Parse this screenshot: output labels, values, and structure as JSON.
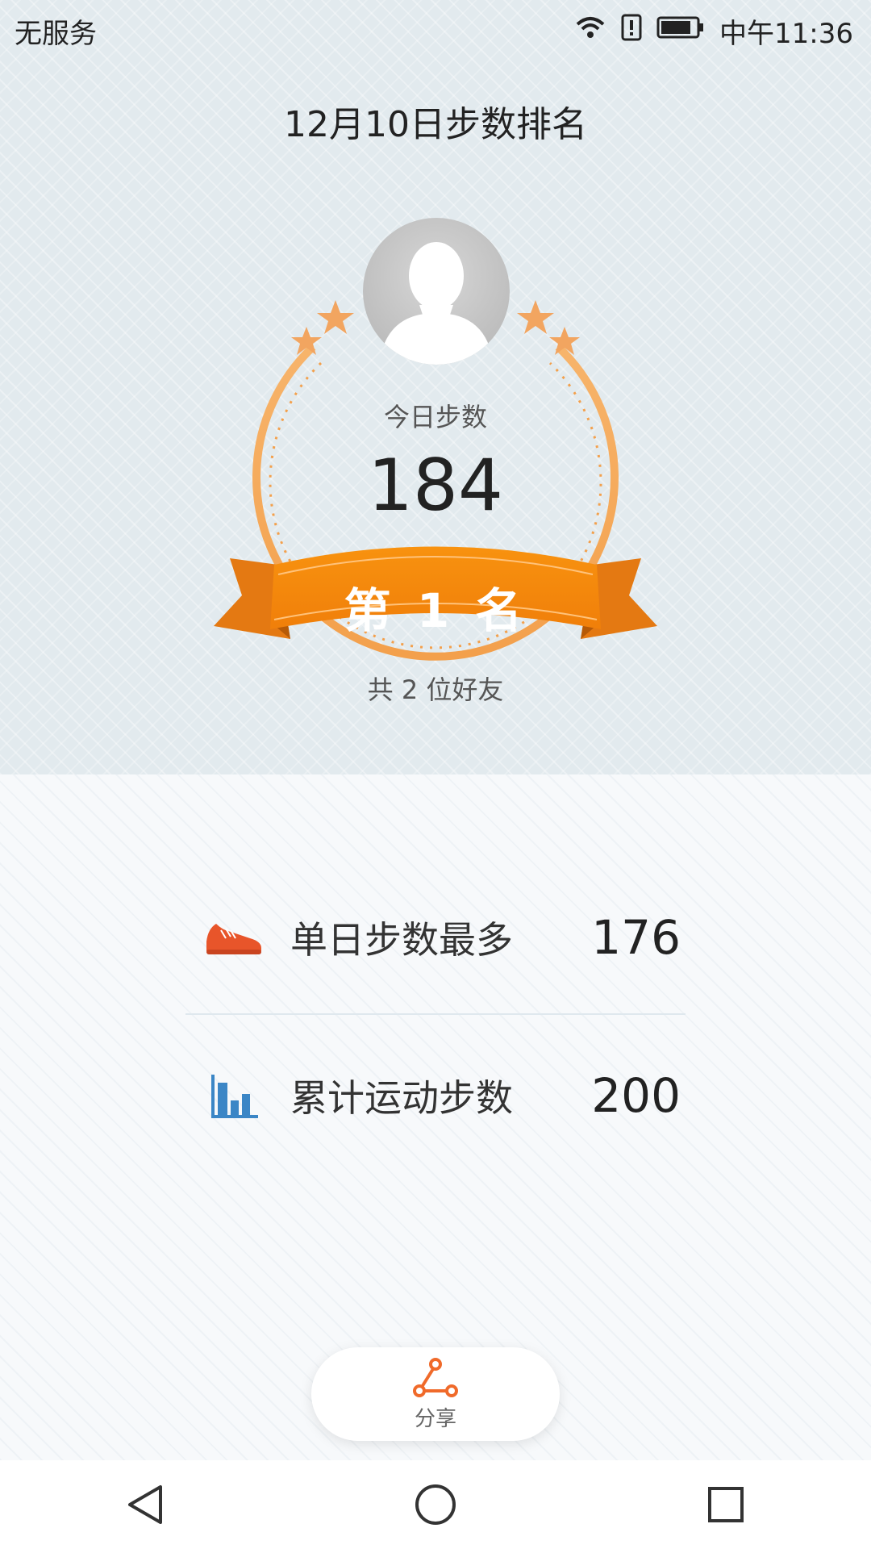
{
  "status_bar": {
    "carrier": "无服务",
    "time": "中午11:36",
    "icons": [
      "wifi-icon",
      "sim-alert-icon",
      "battery-icon"
    ]
  },
  "page": {
    "title": "12月10日步数排名"
  },
  "badge": {
    "avatar": "avatar-icon",
    "today_label": "今日步数",
    "today_steps": "184",
    "rank": "第 1 名",
    "friends": "共 2 位好友"
  },
  "stats": [
    {
      "icon": "shoe-icon",
      "label": "单日步数最多",
      "value": "176"
    },
    {
      "icon": "bar-chart-icon",
      "label": "累计运动步数",
      "value": "200"
    }
  ],
  "share": {
    "icon": "share-icon",
    "label": "分享"
  },
  "nav": {
    "icons": [
      "back-icon",
      "home-icon",
      "recents-icon"
    ]
  },
  "colors": {
    "accent_orange": "#f18a1c",
    "ribbon_dark": "#d96f10",
    "share_icon": "#f06a2a",
    "chart_blue": "#3b86c6"
  }
}
